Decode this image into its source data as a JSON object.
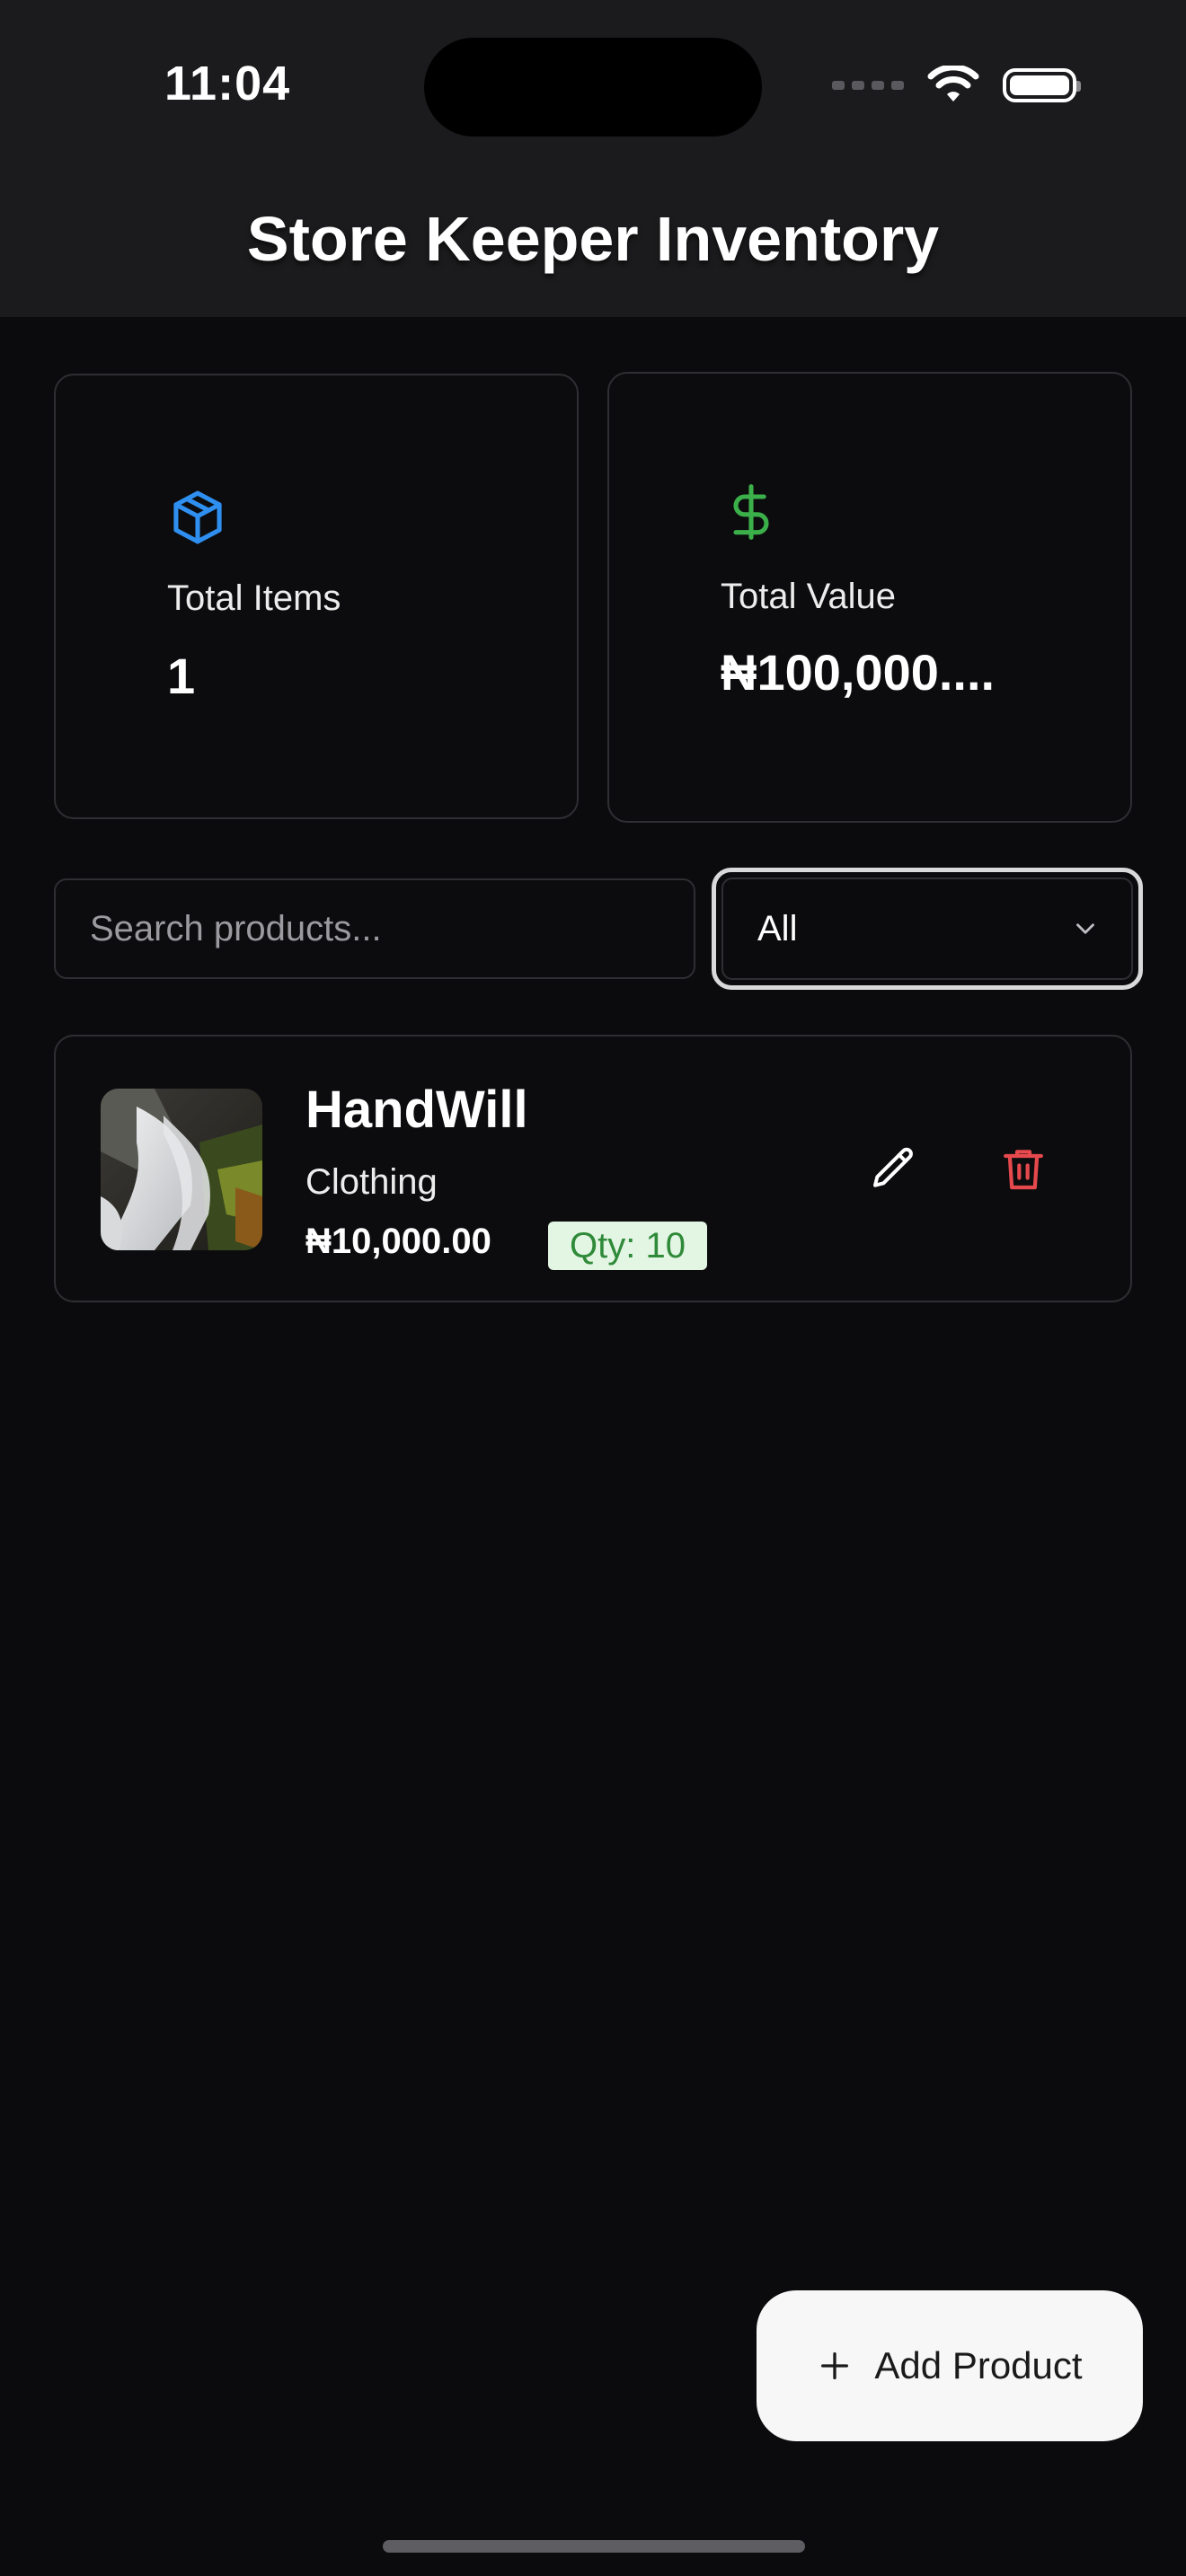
{
  "status_bar": {
    "time": "11:04"
  },
  "header": {
    "title": "Store Keeper Inventory"
  },
  "stats": {
    "total_items": {
      "label": "Total Items",
      "value": "1",
      "icon": "package-icon",
      "color": "#2f8ff0"
    },
    "total_value": {
      "label": "Total Value",
      "value": "₦100,000....",
      "icon": "dollar-icon",
      "color": "#3bb04a"
    }
  },
  "search": {
    "placeholder": "Search products...",
    "value": ""
  },
  "filter": {
    "selected": "All"
  },
  "products": [
    {
      "name": "HandWill",
      "category": "Clothing",
      "price": "₦10,000.00",
      "quantity": "Qty: 10"
    }
  ],
  "actions": {
    "add_product": "Add Product"
  },
  "colors": {
    "background": "#0b0b0d",
    "header_background": "#1b1b1d",
    "delete": "#e5484d",
    "qty_badge_bg": "#e3f5e3",
    "qty_badge_text": "#2f8a39"
  }
}
